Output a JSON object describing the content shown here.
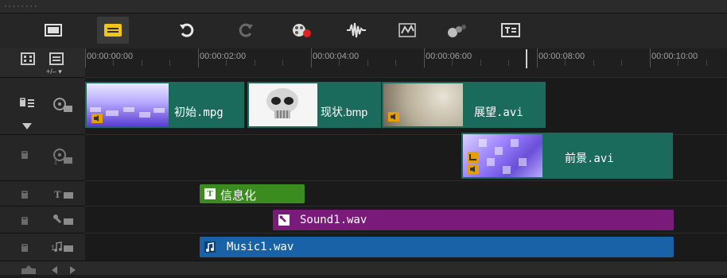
{
  "toolbar": {
    "tools": [
      {
        "icon": "storyboard-view-icon"
      },
      {
        "icon": "timeline-view-icon"
      },
      {
        "icon": "undo-icon"
      },
      {
        "icon": "redo-icon"
      },
      {
        "icon": "record-capture-icon"
      },
      {
        "icon": "audio-mixer-icon"
      },
      {
        "icon": "auto-music-icon"
      },
      {
        "icon": "motion-tracking-icon"
      },
      {
        "icon": "subtitle-editor-icon"
      }
    ]
  },
  "header": {
    "zoom_label": "+/– ▾"
  },
  "ruler": {
    "ticks": [
      "00:00:00:00",
      "00:00:02:00",
      "00:00:04:00",
      "00:00:06:00",
      "00:00:08:00",
      "00:00:10:00"
    ]
  },
  "tracks": {
    "video": {
      "clips": [
        {
          "label": "初始.mpg"
        },
        {
          "label": "现状.bmp"
        },
        {
          "label": "展望.avi"
        }
      ]
    },
    "overlay": {
      "clips": [
        {
          "label": "前景.avi"
        }
      ]
    },
    "title": {
      "clips": [
        {
          "label": "信息化",
          "badge": "T"
        }
      ]
    },
    "voice": {
      "clips": [
        {
          "label": "Sound1.wav"
        }
      ]
    },
    "music": {
      "clips": [
        {
          "label": "Music1.wav"
        }
      ]
    }
  },
  "colors": {
    "video_clip": "#1a6b5c",
    "title_clip": "#3a8c1e",
    "voice_clip": "#7a1a7a",
    "music_clip": "#1a62a8"
  }
}
